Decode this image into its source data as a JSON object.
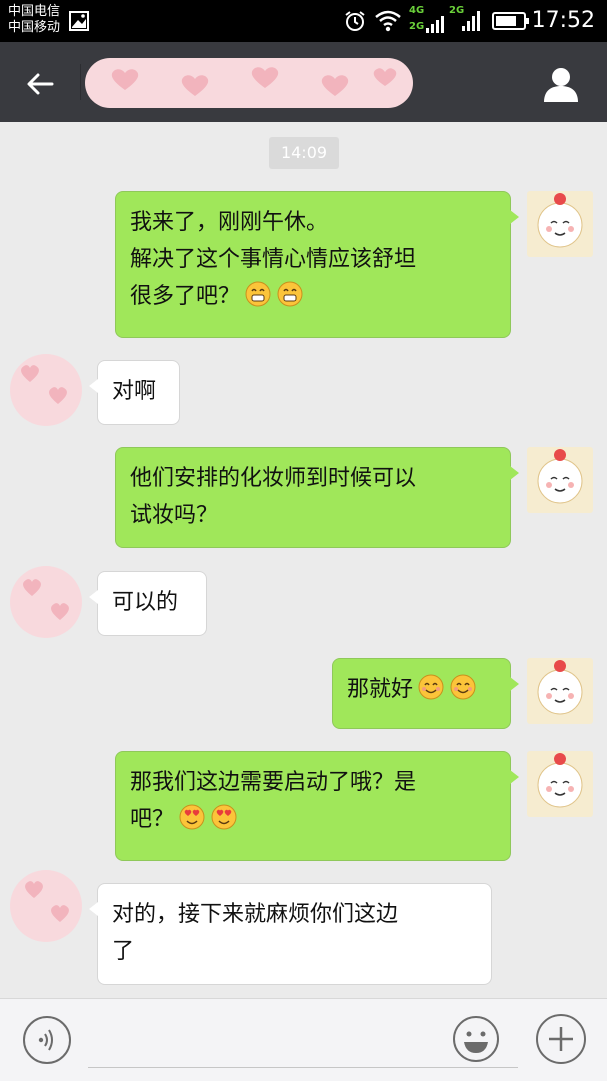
{
  "status_bar": {
    "carrier_1": "中国电信",
    "carrier_2": "中国移动",
    "network_1": "4G",
    "network_2": "2G",
    "network_3": "2G",
    "time": "17:52",
    "icons": [
      "image-icon",
      "alarm-icon",
      "wifi-icon",
      "signal-icon",
      "battery-icon"
    ]
  },
  "header": {
    "back_icon": "arrow-left-icon",
    "title": "",
    "profile_icon": "person-icon"
  },
  "chat": {
    "timestamp": "14:09",
    "messages": [
      {
        "side": "me",
        "lines": [
          "我来了，刚刚午休。",
          "解决了这个事情心情应该舒坦",
          "很多了吧？"
        ],
        "emoji": [
          "grin-emoji",
          "grin-emoji"
        ]
      },
      {
        "side": "other",
        "lines": [
          "对啊"
        ],
        "emoji": []
      },
      {
        "side": "me",
        "lines": [
          "他们安排的化妆师到时候可以",
          "试妆吗？"
        ],
        "emoji": []
      },
      {
        "side": "other",
        "lines": [
          "可以的"
        ],
        "emoji": []
      },
      {
        "side": "me",
        "lines": [
          "那就好"
        ],
        "emoji": [
          "smile-emoji",
          "smile-emoji"
        ]
      },
      {
        "side": "me",
        "lines": [
          "那我们这边需要启动了哦？是",
          "吧？"
        ],
        "emoji": [
          "heart-eyes-emoji",
          "heart-eyes-emoji"
        ]
      },
      {
        "side": "other",
        "lines": [
          "对的，接下来就麻烦你们这边",
          "了"
        ],
        "emoji": []
      }
    ]
  },
  "input_bar": {
    "voice_icon": "voice-icon",
    "input_value": "",
    "emoji_icon": "smiley-icon",
    "more_icon": "plus-icon"
  },
  "colors": {
    "app_bar": "#393a3f",
    "chat_bg": "#ebebeb",
    "outgoing_bubble": "#a0e75a",
    "incoming_bubble": "#ffffff",
    "privacy_mask": "#f8d9dd"
  }
}
